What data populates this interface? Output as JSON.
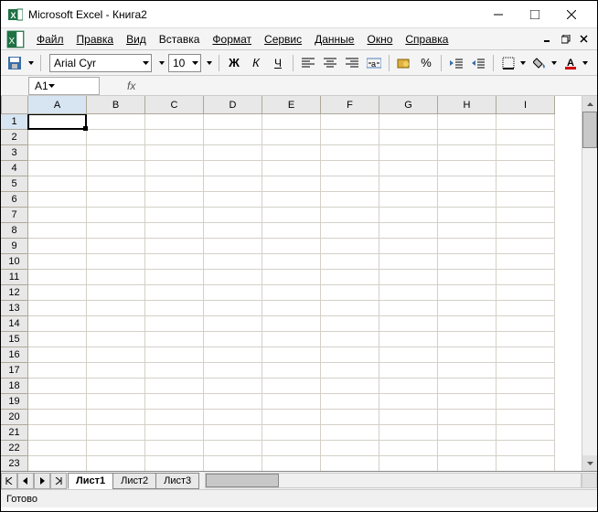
{
  "title": "Microsoft Excel - Книга2",
  "menu": {
    "file": "Файл",
    "edit": "Правка",
    "view": "Вид",
    "insert": "Вставка",
    "format": "Формат",
    "tools": "Сервис",
    "data": "Данные",
    "window": "Окно",
    "help": "Справка"
  },
  "toolbar": {
    "font_name": "Arial Cyr",
    "font_size": "10",
    "percent_label": "%"
  },
  "namebox": {
    "value": "A1",
    "fx": "fx"
  },
  "columns": [
    "A",
    "B",
    "C",
    "D",
    "E",
    "F",
    "G",
    "H",
    "I"
  ],
  "rows": [
    "1",
    "2",
    "3",
    "4",
    "5",
    "6",
    "7",
    "8",
    "9",
    "10",
    "11",
    "12",
    "13",
    "14",
    "15",
    "16",
    "17",
    "18",
    "19",
    "20",
    "21",
    "22",
    "23"
  ],
  "active_cell": {
    "col": 0,
    "row": 0
  },
  "sheets": {
    "tabs": [
      "Лист1",
      "Лист2",
      "Лист3"
    ],
    "active": 0
  },
  "status": "Готово"
}
